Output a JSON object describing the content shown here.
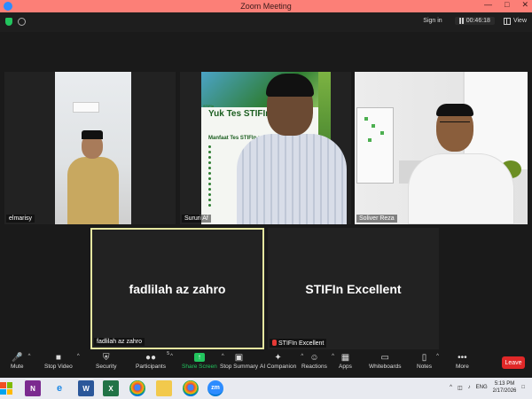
{
  "window": {
    "title": "Zoom Meeting"
  },
  "topbar": {
    "sign_in": "Sign in",
    "timer": "00:46:18",
    "view": "View"
  },
  "participants": {
    "tile1": "elmarisy",
    "tile2": "Sururi Af",
    "tile3": "Soliver Reza",
    "tile4": {
      "big": "fadlilah az zahro",
      "tag": "fadlilah az zahro"
    },
    "tile5": {
      "big": "STIFIn Excellent",
      "tag": "STIFIn Excellent"
    }
  },
  "poster": {
    "title": "Yuk Tes STIFIn",
    "subtitle": "Manfaat Tes STIFIn :",
    "brand": "STIFIn"
  },
  "toolbar": {
    "mute": "Mute",
    "stop_video": "Stop Video",
    "security": "Security",
    "participants": "Participants",
    "participants_count": "5",
    "share_screen": "Share Screen",
    "stop_summary": "Stop Summary",
    "ai_companion": "AI Companion",
    "reactions": "Reactions",
    "apps": "Apps",
    "whiteboards": "Whiteboards",
    "notes": "Notes",
    "more": "More",
    "leave": "Leave"
  },
  "taskbar": {
    "lang": "ENG",
    "time": "5:13 PM",
    "date": "2/17/2026"
  },
  "colors": {
    "title_bar": "#fc7f77",
    "share_green": "#22c55e",
    "leave_red": "#e02828",
    "speaker_border": "#e5e6a0"
  }
}
